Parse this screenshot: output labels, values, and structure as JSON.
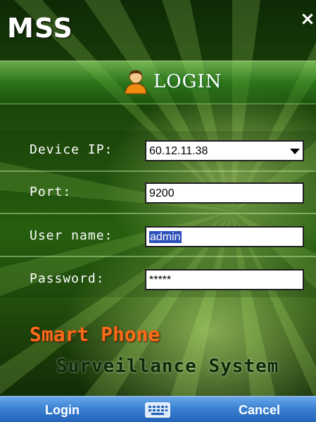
{
  "app": {
    "title": "MSS",
    "close_glyph": "×"
  },
  "header": {
    "label": "LOGIN",
    "icon": "user-icon"
  },
  "form": {
    "device_ip": {
      "label": "Device IP:",
      "value": "60.12.11.38"
    },
    "port": {
      "label": "Port:",
      "value": "9200"
    },
    "username": {
      "label": "User name:",
      "value": "admin"
    },
    "password": {
      "label": "Password:",
      "value": "*****"
    }
  },
  "slogan": {
    "line1": "Smart Phone",
    "line2": "Surveillance System"
  },
  "softkeys": {
    "left": "Login",
    "right": "Cancel",
    "center_icon": "keyboard-icon"
  },
  "colors": {
    "slogan_orange": "#ff6a1a",
    "softbar_blue": "#3c83d4",
    "selection_blue": "#2a4fb8",
    "background_green": "#2d6b12"
  }
}
